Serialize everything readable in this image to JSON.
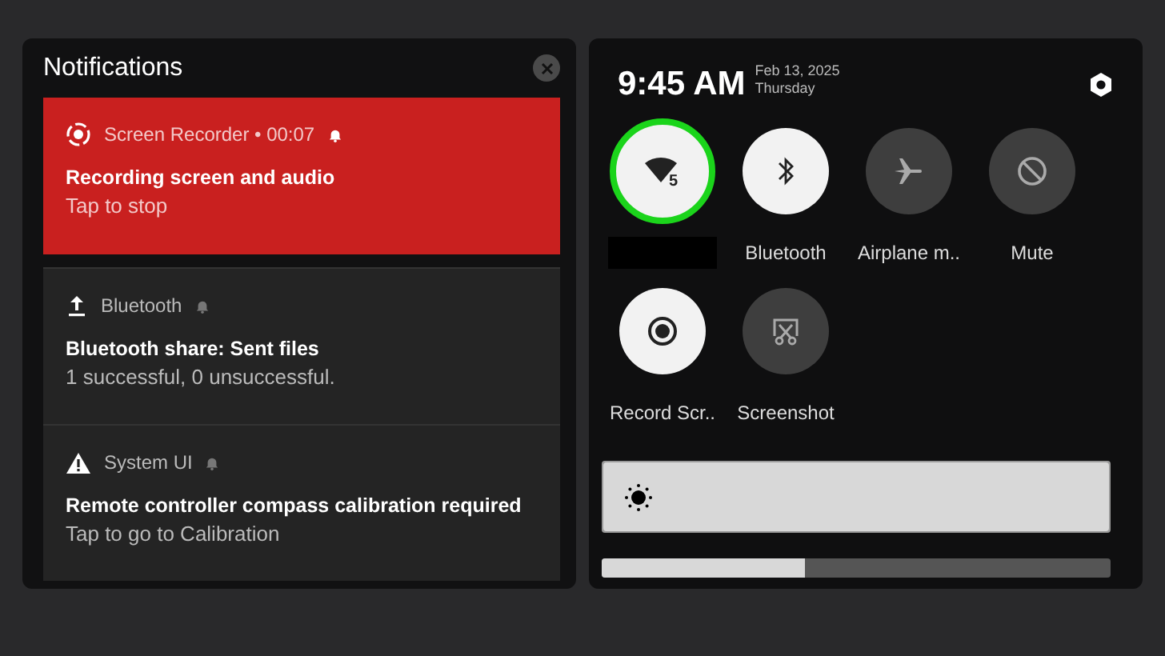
{
  "notifications": {
    "title": "Notifications",
    "items": [
      {
        "kind": "recording",
        "app": "Screen Recorder • 00:07",
        "title": "Recording screen and audio",
        "text": "Tap to stop",
        "highlighted": true
      },
      {
        "kind": "upload",
        "app": "Bluetooth",
        "title": "Bluetooth share: Sent files",
        "text": "1 successful, 0 unsuccessful.",
        "highlighted": false
      },
      {
        "kind": "warning",
        "app": "System UI",
        "title": "Remote controller compass calibration required",
        "text": "Tap to go to Calibration",
        "highlighted": false
      }
    ]
  },
  "quick_settings": {
    "time": "9:45 AM",
    "date": "Feb 13, 2025",
    "weekday": "Thursday",
    "tiles": [
      {
        "kind": "wifi",
        "badge": "5",
        "on": true,
        "focused": true,
        "redacted": true
      },
      {
        "kind": "bluetooth",
        "label": "Bluetooth",
        "on": true,
        "focused": false
      },
      {
        "kind": "airplane",
        "label": "Airplane m..",
        "on": false,
        "focused": false
      },
      {
        "kind": "mute",
        "label": "Mute",
        "on": false,
        "focused": false
      },
      {
        "kind": "record",
        "label": "Record Scr..",
        "on": true,
        "focused": false
      },
      {
        "kind": "screenshot",
        "label": "Screenshot",
        "on": false,
        "focused": false
      }
    ],
    "brightness": {
      "level": 1
    },
    "volume": {
      "level": 0.4
    }
  }
}
